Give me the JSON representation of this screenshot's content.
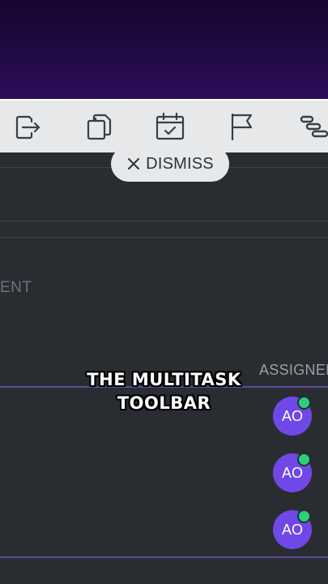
{
  "toolbar": {
    "icons": [
      {
        "name": "move-out-icon"
      },
      {
        "name": "duplicate-icon"
      },
      {
        "name": "calendar-check-icon"
      },
      {
        "name": "flag-icon"
      },
      {
        "name": "gantt-icon"
      }
    ],
    "dismiss_label": "DISMISS"
  },
  "table": {
    "partial_label": "ENT",
    "assignee_header": "ASSIGNEE",
    "rows": [
      {
        "assignee_initials": "AO",
        "online": true
      },
      {
        "assignee_initials": "AO",
        "online": true
      },
      {
        "assignee_initials": "AO",
        "online": true
      }
    ]
  },
  "caption": {
    "line1": "THE MULTITASK",
    "line2": "TOOLBAR"
  },
  "colors": {
    "avatar": "#7048e8",
    "online": "#28d27a",
    "toolbar_bg": "#e6e8e9",
    "page_bg": "#292d32"
  }
}
